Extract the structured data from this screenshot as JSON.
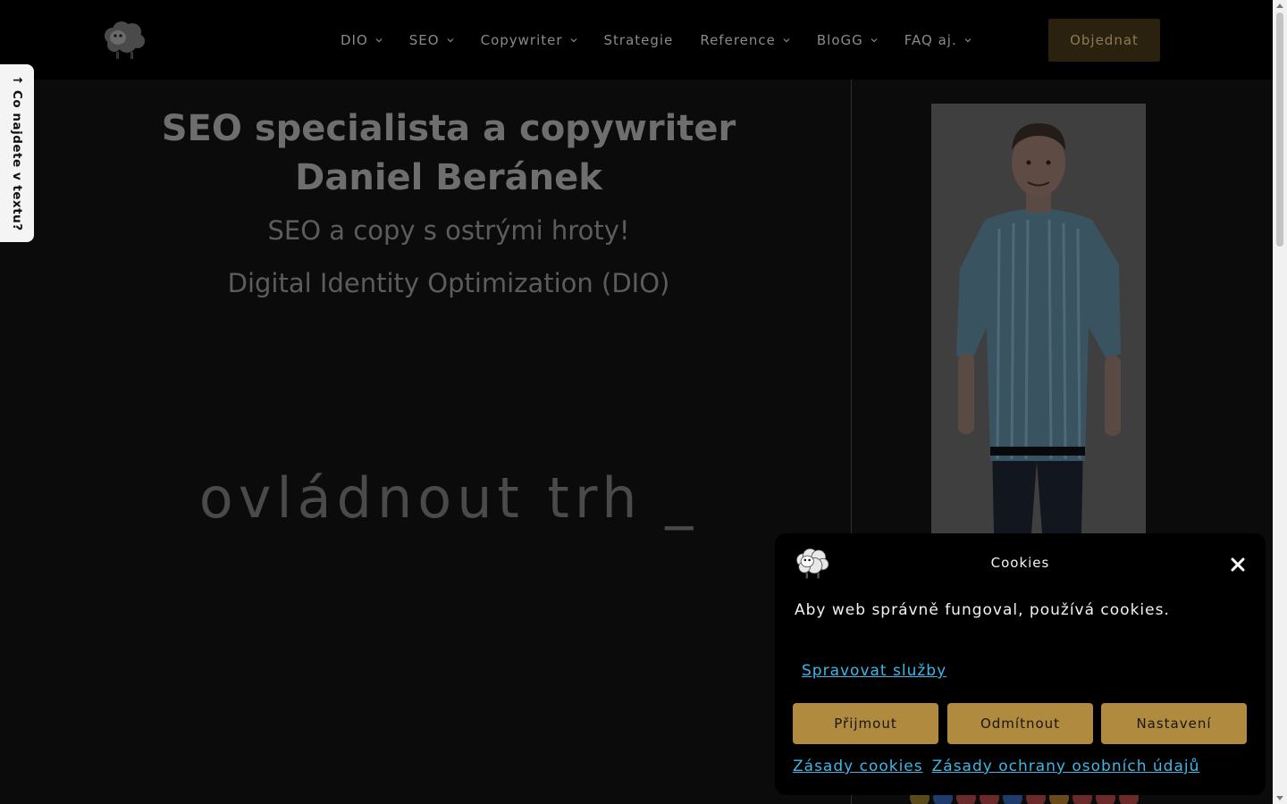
{
  "header": {
    "logo_icon": "sheep-logo-icon",
    "nav": [
      {
        "label": "DIO",
        "has_dropdown": true
      },
      {
        "label": "SEO",
        "has_dropdown": true
      },
      {
        "label": "Copywriter",
        "has_dropdown": true
      },
      {
        "label": "Strategie",
        "has_dropdown": false
      },
      {
        "label": "Reference",
        "has_dropdown": true
      },
      {
        "label": "BloGG",
        "has_dropdown": true
      },
      {
        "label": "FAQ aj.",
        "has_dropdown": true
      }
    ],
    "cta_label": "Objednat"
  },
  "side_tab": {
    "label": "↑ Co najdete v textu?"
  },
  "hero": {
    "title_line1": "SEO specialista a copywriter",
    "title_line2": "Daniel Beránek",
    "subtitle": "SEO a copy s ostrými hroty!",
    "subtitle2": "Digital Identity Optimization (DIO)",
    "typed_text": "ovládnout trh _"
  },
  "cookie": {
    "title": "Cookies",
    "text": "Aby web správně fungoval, používá cookies.",
    "manage_link": "Spravovat služby",
    "accept": "Přijmout",
    "reject": "Odmítnout",
    "settings": "Nastavení",
    "policy_link": "Zásady cookies",
    "privacy_link": "Zásady ochrany osobních údajů"
  },
  "colors": {
    "background": "#0b0b0b",
    "header": "#000000",
    "accent_gold": "#b08a3e",
    "link_blue": "#3db7e6"
  }
}
